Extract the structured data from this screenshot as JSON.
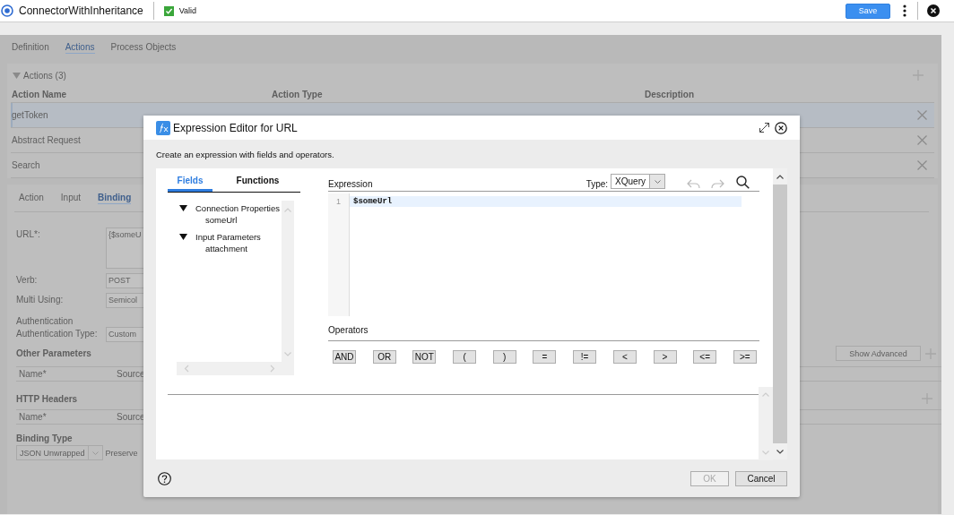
{
  "header": {
    "title": "ConnectorWithInheritance",
    "status": {
      "label": "Valid",
      "valid": true
    },
    "save_label": "Save"
  },
  "page_tabs": [
    {
      "label": "Definition",
      "selected": false
    },
    {
      "label": "Actions",
      "selected": true
    },
    {
      "label": "Process Objects",
      "selected": false
    }
  ],
  "actions": {
    "heading": "Actions (3)",
    "expanded": true,
    "columns": [
      "Action Name",
      "Action Type",
      "Description"
    ],
    "rows": [
      {
        "name": "getToken",
        "selected": true
      },
      {
        "name": "Abstract Request",
        "selected": false
      },
      {
        "name": "Search",
        "selected": false
      }
    ]
  },
  "detail_tabs": [
    {
      "label": "Action",
      "selected": false
    },
    {
      "label": "Input",
      "selected": false
    },
    {
      "label": "Binding",
      "selected": true
    }
  ],
  "binding": {
    "fields": [
      {
        "kind": "textarea",
        "label": "URL*:",
        "value": "{$someU"
      },
      {
        "kind": "input",
        "label": "Verb:",
        "value": "POST"
      },
      {
        "kind": "input",
        "label": "Multi Using:",
        "value": "Semicol"
      },
      {
        "kind": "heading",
        "label": "Authentication"
      },
      {
        "kind": "input",
        "label": "Authentication Type:",
        "value": "Custom"
      }
    ],
    "other_parameters": {
      "title": "Other Parameters",
      "button": "Show Advanced",
      "columns": [
        "Name*",
        "Source"
      ]
    },
    "http_headers": {
      "title": "HTTP Headers",
      "columns": [
        "Name*",
        "Source"
      ]
    },
    "binding_type": {
      "title": "Binding Type",
      "value": "JSON Unwrapped",
      "option": "Preserve"
    }
  },
  "dialog": {
    "title": "Expression Editor for URL",
    "instruction": "Create an expression with fields and operators.",
    "tabs": [
      {
        "label": "Fields",
        "selected": true
      },
      {
        "label": "Functions",
        "selected": false
      }
    ],
    "tree": [
      {
        "label": "Connection Properties",
        "expanded": true,
        "children": [
          {
            "label": "someUrl"
          }
        ]
      },
      {
        "label": "Input Parameters",
        "expanded": true,
        "children": [
          {
            "label": "attachment"
          }
        ]
      }
    ],
    "expression_label": "Expression",
    "type_label": "Type:",
    "type_value": "XQuery",
    "code_lines": [
      {
        "number": "1",
        "text": "$someUrl",
        "active": true
      }
    ],
    "operators_label": "Operators",
    "operators": [
      "AND",
      "OR",
      "NOT",
      "(",
      ")",
      "=",
      "!=",
      "<",
      ">",
      "<=",
      ">="
    ],
    "buttons": [
      {
        "label": "OK",
        "disabled": true
      },
      {
        "label": "Cancel",
        "disabled": false
      }
    ]
  }
}
